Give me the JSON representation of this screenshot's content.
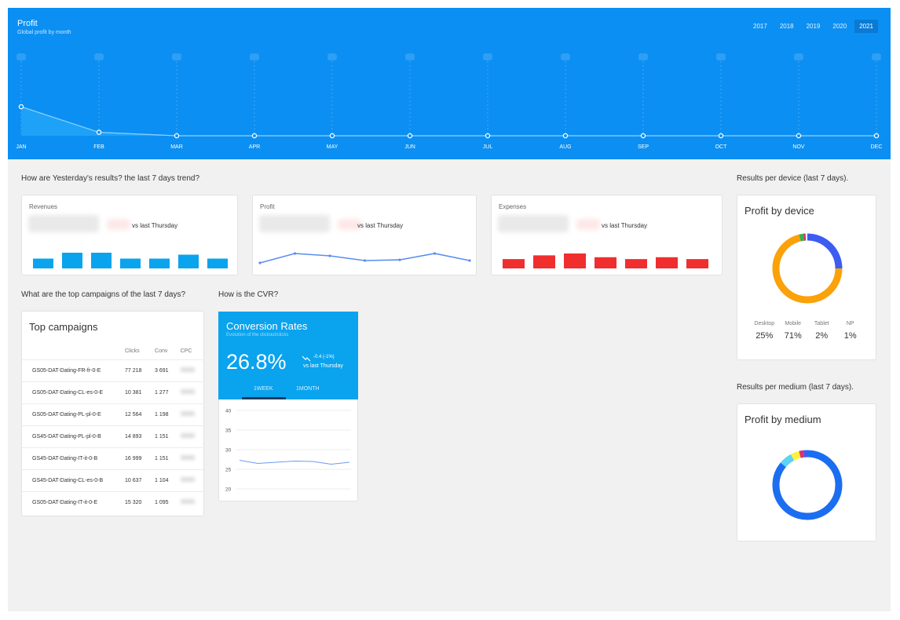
{
  "header": {
    "title": "Profit",
    "subtitle": "Global profit by month",
    "years": [
      "2017",
      "2018",
      "2019",
      "2020",
      "2021"
    ],
    "selected_year": "2021",
    "months": [
      "JAN",
      "FEB",
      "MAR",
      "APR",
      "MAY",
      "JUN",
      "JUL",
      "AUG",
      "SEP",
      "OCT",
      "NOV",
      "DEC"
    ],
    "profit_level": [
      1.0,
      0.12,
      0,
      0,
      0,
      0,
      0,
      0,
      0,
      0,
      0,
      0
    ]
  },
  "kpis": {
    "section_label": "How are Yesterday's results? the last 7 days trend?",
    "vs_label": "vs last Thursday",
    "revenues": {
      "label": "Revenues",
      "values": [
        5,
        8,
        8,
        5,
        5,
        7,
        5
      ],
      "color": "#0aa3ee"
    },
    "profit": {
      "label": "Profit",
      "values": [
        3,
        7,
        6,
        4,
        4.3,
        7,
        4
      ],
      "color": "#5b8def"
    },
    "expenses": {
      "label": "Expenses",
      "values": [
        5,
        7,
        8,
        6,
        5,
        6,
        5
      ],
      "color": "#f02e2e"
    }
  },
  "campaigns": {
    "section_label": "What are the top campaigns of the last 7 days?",
    "title": "Top campaigns",
    "columns": [
      "",
      "Clicks",
      "Conv",
      "CPC"
    ],
    "rows": [
      [
        "GS05-DAT-Dating-FR-fr-0-E",
        "77 218",
        "3 691"
      ],
      [
        "GS05-DAT-Dating-CL-es-0-E",
        "10 381",
        "1 277"
      ],
      [
        "GS05-DAT-Dating-PL-pl-0-E",
        "12 564",
        "1 198"
      ],
      [
        "GS45-DAT-Dating-PL-pl-0-B",
        "14 893",
        "1 151"
      ],
      [
        "GS45-DAT-Dating-IT-it-0-B",
        "16 999",
        "1 151"
      ],
      [
        "GS45-DAT-Dating-CL-es-0-B",
        "10 637",
        "1 104"
      ],
      [
        "GS05-DAT-Dating-IT-it-0-E",
        "15 320",
        "1 095"
      ]
    ]
  },
  "cvr": {
    "section_label": "How is the CVR?",
    "title": "Conversion Rates",
    "subtitle": "Evolution of the clickout/clicks",
    "value": "26.8%",
    "change": "-0.4 (-1%)",
    "vs_label": "vs last Thursday",
    "tabs": [
      "1WEEK",
      "1MONTH"
    ],
    "active_tab": "1WEEK",
    "chart_data": {
      "type": "line",
      "y_ticks": [
        "40",
        "35",
        "30",
        "25",
        "20"
      ],
      "ylim": [
        20,
        40
      ],
      "values": [
        27.3,
        26.5,
        26.8,
        27.1,
        27.0,
        26.3,
        26.8
      ]
    }
  },
  "device": {
    "section_label": "Results per device (last 7 days).",
    "title": "Profit by device",
    "segments": [
      {
        "name": "Desktop",
        "value": "25%",
        "pct": 25,
        "color": "#3d5cf0"
      },
      {
        "name": "Mobile",
        "value": "71%",
        "pct": 71,
        "color": "#fba10a"
      },
      {
        "name": "Tablet",
        "value": "2%",
        "pct": 2,
        "color": "#37b24d"
      },
      {
        "name": "NP",
        "value": "1%",
        "pct": 1,
        "color": "#d6336c"
      }
    ]
  },
  "medium": {
    "section_label": "Results per medium (last 7 days).",
    "title": "Profit by medium",
    "segments": [
      {
        "pct": 86,
        "color": "#1b6ef0"
      },
      {
        "pct": 6,
        "color": "#5fd3f3"
      },
      {
        "pct": 4,
        "color": "#fff13c"
      },
      {
        "pct": 2,
        "color": "#d6336c"
      },
      {
        "pct": 2,
        "color": "#3d5cf0"
      }
    ]
  }
}
